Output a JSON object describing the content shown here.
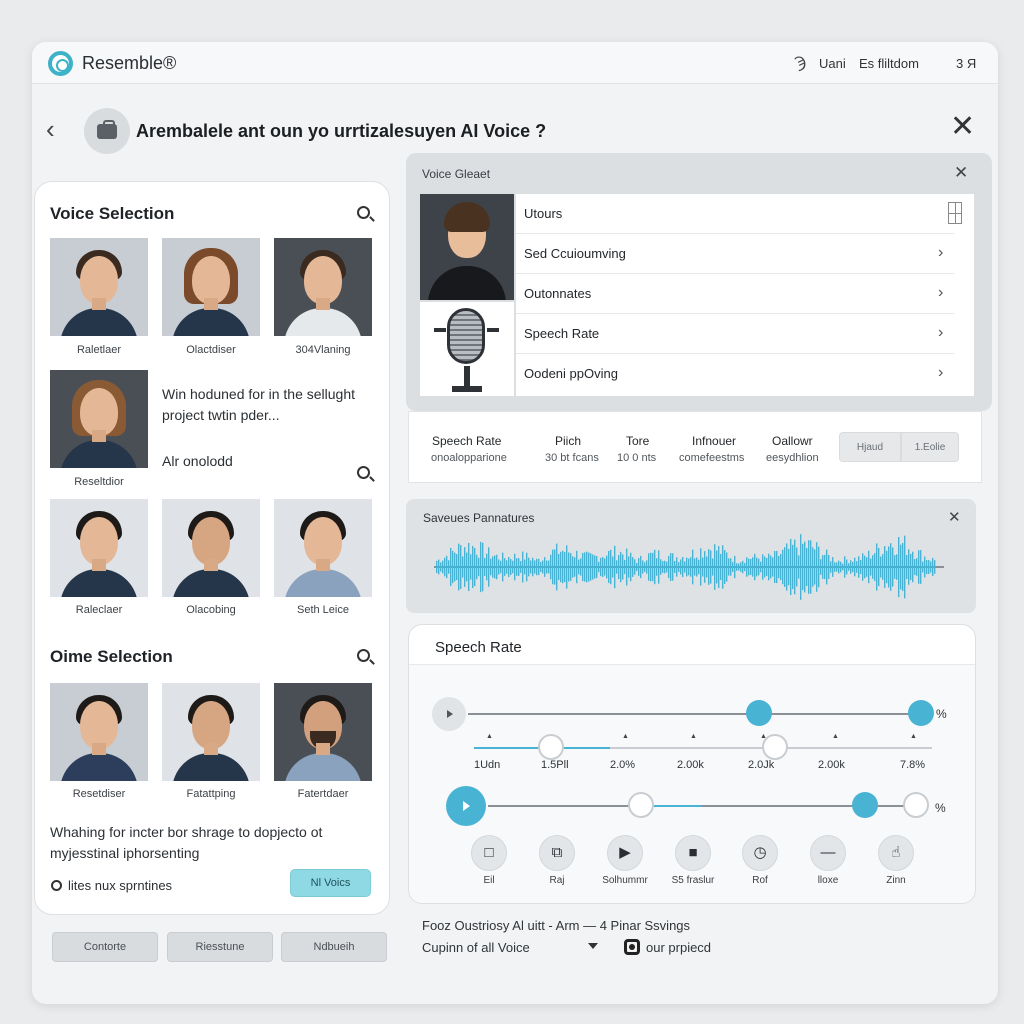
{
  "app": {
    "name": "Resemble®"
  },
  "top_bar": {
    "user_icon": "Ϡ",
    "user": "Uani",
    "link": "Es fliltdom",
    "count": "3 Я"
  },
  "header": {
    "title": "Arembalele ant oun yo urrtizalesuyen AI Voice ?"
  },
  "voice_selection": {
    "title": "Voice Selection",
    "row1": [
      "Raletlaer",
      "Olactdiser",
      "304Vlaning"
    ],
    "featured_label": "Reseltdior",
    "featured_text_1": "Win hoduned for in the sellught",
    "featured_text_2": "project twtin pder...",
    "featured_text_3": "Alr onolodd",
    "row2": [
      "Raleclaer",
      "Olacobing",
      "Seth Leice"
    ]
  },
  "oime_selection": {
    "title": "Oime Selection",
    "row": [
      "Resetdiser",
      "Fatattping",
      "Fatertdaer"
    ],
    "desc_1": "Whahing for incter bor shrage to dopjecto ot",
    "desc_2": "myjesstinal iphorsenting",
    "lites_text": "lites nux sprntines",
    "voices_button": "Nl Voics"
  },
  "bottom_buttons": [
    "Contorte",
    "Riesstune",
    "Ndbueih"
  ],
  "voice_select": {
    "title": "Voice Gleaet",
    "options": [
      "Utours",
      "Sed Ccuioumving",
      "Outonnates",
      "Speech Rate",
      "Oodeni ppOving"
    ]
  },
  "params": [
    {
      "name": "Speech Rate",
      "value": "onoalopparione"
    },
    {
      "name": "Piich",
      "value": "30 bt fcans"
    },
    {
      "name": "Tore",
      "value": "10 0 nts"
    },
    {
      "name": "Infnouer",
      "value": "comefeestms"
    },
    {
      "name": "Oallowr",
      "value": "eesydhlion"
    }
  ],
  "segments": [
    "Hjaud",
    "1.Eolie"
  ],
  "waveform": {
    "title": "Saveues Pannatures",
    "color": "#49b3d3"
  },
  "speech_rate": {
    "title": "Speech Rate",
    "pct_1": "%",
    "pct_2": "%",
    "tick_labels": [
      "1Udn",
      "1.5Pll",
      "2.0%",
      "2.00k",
      "2.0Jk",
      "2.00k",
      "7.8%"
    ],
    "controls": [
      {
        "label": "Eil",
        "icon": "square-outline-icon"
      },
      {
        "label": "Raj",
        "icon": "copy-icon"
      },
      {
        "label": "Solhummr",
        "icon": "play-icon"
      },
      {
        "label": "S5 fraslur",
        "icon": "stop-icon"
      },
      {
        "label": "Rof",
        "icon": "clock-icon"
      },
      {
        "label": "lloxe",
        "icon": "minus-icon"
      },
      {
        "label": "Zinn",
        "icon": "thumbs-up-icon"
      }
    ]
  },
  "footer": {
    "line_1": "Fooz Oustriosy Al uitt - Arm — 4 Pinar Ssvings",
    "line_2": "Cupinn of all Voice",
    "line_3": "our prpiecd"
  },
  "colors": {
    "accent": "#49b3d3",
    "brand": "#3db2c9"
  }
}
